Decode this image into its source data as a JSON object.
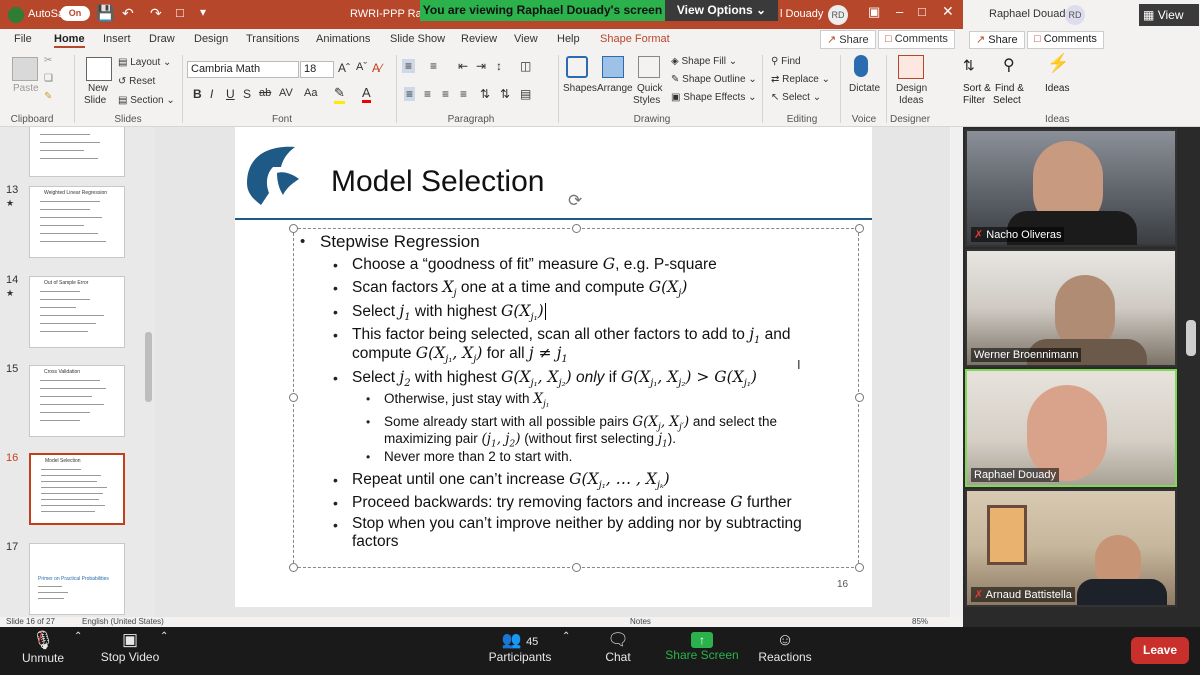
{
  "titlebar": {
    "autosave": "AutoSave",
    "toggle": "On",
    "doc_title": "RWRI-PPP Ra",
    "user": "l Douady",
    "user_initials": "RD"
  },
  "share_banner": {
    "text": "You are viewing Raphael Douady's screen",
    "view_options": "View Options"
  },
  "tabs": [
    "File",
    "Home",
    "Insert",
    "Draw",
    "Design",
    "Transitions",
    "Animations",
    "Slide Show",
    "Review",
    "View",
    "Help",
    "Shape Format"
  ],
  "active_tab": "Home",
  "top_actions": {
    "share": "Share",
    "comments": "Comments"
  },
  "ribbon": {
    "clipboard": {
      "paste": "Paste",
      "label": "Clipboard"
    },
    "slides": {
      "new_slide_1": "New",
      "new_slide_2": "Slide",
      "layout": "Layout",
      "reset": "Reset",
      "section": "Section",
      "label": "Slides"
    },
    "font": {
      "name": "Cambria Math",
      "size": "18",
      "label": "Font"
    },
    "paragraph": {
      "label": "Paragraph"
    },
    "drawing": {
      "shapes": "Shapes",
      "arrange": "Arrange",
      "quick_1": "Quick",
      "quick_2": "Styles",
      "shape_fill": "Shape Fill",
      "shape_outline": "Shape Outline",
      "shape_effects": "Shape Effects",
      "label": "Drawing"
    },
    "editing": {
      "find": "Find",
      "replace": "Replace",
      "select": "Select",
      "label": "Editing"
    },
    "voice": {
      "dictate": "Dictate",
      "label": "Voice"
    },
    "designer": {
      "design_1": "Design",
      "design_2": "Ideas",
      "label": "Designer"
    }
  },
  "thumbnails": [
    {
      "num": "13",
      "title": "Weighted Linear Regression"
    },
    {
      "num": "14",
      "title": "Out of Sample Error"
    },
    {
      "num": "15",
      "title": "Cross Validation"
    },
    {
      "num": "16",
      "title": "Model Selection"
    },
    {
      "num": "17",
      "title": "Primer on Practical Probabilities"
    }
  ],
  "slide": {
    "title": "Model Selection",
    "page_number": "16",
    "l1": "Stepwise Regression",
    "l2a_pre": "Choose a “goodness of fit” measure ",
    "l2a_var": "G",
    "l2a_post": ", e.g. P-square",
    "l2b_pre": "Scan factors ",
    "l2b_m1": "X",
    "l2b_s1": "j",
    "l2b_mid": " one at a time and compute ",
    "l2b_m2": "G(X",
    "l2b_s2": "j",
    "l2b_end": ")",
    "l2c_pre": "Select ",
    "l2c_m1": "j",
    "l2c_s1": "1",
    "l2c_mid": " with highest ",
    "l2c_m2": "G(X",
    "l2c_s2": "j₁",
    "l2c_end": ")",
    "l2d_line1_pre": "This factor being selected, scan all other factors to add to ",
    "l2d_m1": "j",
    "l2d_s1": "1",
    "l2d_line1_post": " and",
    "l2d_line2_pre": "compute ",
    "l2d_m2": "G(X",
    "l2d_s2": "j₁",
    "l2d_m3": ", X",
    "l2d_s3": "j",
    "l2d_end": ")",
    "l2d_mid": " for all ",
    "l2d_m4": "j ≠ j",
    "l2d_s4": "1",
    "l2e_pre": "Select ",
    "l2e_m1": "j",
    "l2e_s1": "2",
    "l2e_mid": " with highest ",
    "l2e_m2": "G(X",
    "l2e_s2": "j₁",
    "l2e_m3": ", X",
    "l2e_s3": "j₂",
    "l2e_end": ")",
    "l2e_only": "only",
    "l2e_if": " if ",
    "l2e_m4": "G(X",
    "l2e_s4": "j₁",
    "l2e_m5": ", X",
    "l2e_s5": "j₂",
    "l2e_m6": ") > G(X",
    "l2e_s6": "j₁",
    "l2e_end2": ")",
    "l3a_pre": "Otherwise, just stay with ",
    "l3a_m": "X",
    "l3a_s": "j₁",
    "l3b_line1_pre": "Some already start with all possible pairs ",
    "l3b_m": "G(X",
    "l3b_s1": "j",
    "l3b_m2": ", X",
    "l3b_s2": "j′",
    "l3b_end": ")",
    "l3b_line1_post": " and select the",
    "l3b_line2_pre": "maximizing pair ",
    "l3b_m3": "(j",
    "l3b_s3": "1",
    "l3b_m4": ", j",
    "l3b_s4": "2",
    "l3b_m5": ")",
    "l3b_line2_mid": " (without first selecting ",
    "l3b_m6": "j",
    "l3b_s6": "1",
    "l3b_line2_end": ").",
    "l3c": "Never more than 2 to start with.",
    "l2f_pre": "Repeat until one can’t increase ",
    "l2f_m": "G(X",
    "l2f_s1": "j₁",
    "l2f_mid": ", … , X",
    "l2f_s2": "jₖ",
    "l2f_end": ")",
    "l2g_pre": "Proceed backwards: try removing factors and increase ",
    "l2g_var": "G",
    "l2g_post": " further",
    "l2h_line1": "Stop when you can’t improve neither by adding nor by subtracting",
    "l2h_line2": "factors"
  },
  "statusbar": {
    "slide": "Slide 16 of 27",
    "lang": "English (United States)",
    "notes": "Notes",
    "zoom": "85%"
  },
  "right_panel": {
    "user": "Raphael Douady",
    "initials": "RD",
    "view": "View",
    "share": "Share",
    "comments": "Comments",
    "sort_1": "Sort &",
    "sort_2": "Filter",
    "find_1": "Find &",
    "find_2": "Select",
    "ideas": "Ideas",
    "ideas_label": "Ideas"
  },
  "participants": [
    {
      "name": "Nacho Oliveras",
      "muted": true
    },
    {
      "name": "Werner Broennimann",
      "muted": false
    },
    {
      "name": "Raphael Douady",
      "muted": false
    },
    {
      "name": "Arnaud Battistella",
      "muted": true
    }
  ],
  "zoom_toolbar": {
    "unmute": "Unmute",
    "stop_video": "Stop Video",
    "participants": "Participants",
    "participants_count": "45",
    "chat": "Chat",
    "share_screen": "Share Screen",
    "reactions": "Reactions",
    "leave": "Leave"
  },
  "colors": {
    "ppt_accent": "#b7472a",
    "share_green": "#2bb24c",
    "leave_red": "#c9302c",
    "selected_thumb": "#c43e1c"
  }
}
